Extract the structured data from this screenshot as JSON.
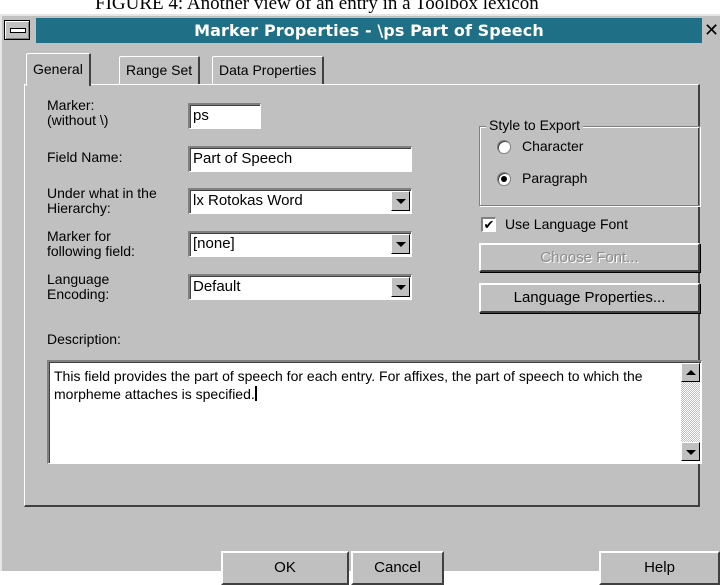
{
  "caption": "FIGURE 4: Another view of an entry in a Toolbox lexicon",
  "window": {
    "title": "Marker Properties - \\ps Part of Speech",
    "close_glyph": "✕"
  },
  "tabs": [
    {
      "label": "General",
      "active": true
    },
    {
      "label": "Range Set",
      "active": false
    },
    {
      "label": "Data Properties",
      "active": false
    }
  ],
  "form": {
    "marker_label_1": "Marker:",
    "marker_label_2": "(without \\)",
    "marker_value": "ps",
    "field_name_label": "Field Name:",
    "field_name_value": "Part of Speech",
    "hierarchy_label_1": "Under what in the",
    "hierarchy_label_2": "Hierarchy:",
    "hierarchy_value": "lx  Rotokas Word",
    "following_label_1": "Marker for",
    "following_label_2": "following field:",
    "following_value": "[none]",
    "encoding_label_1": "Language",
    "encoding_label_2": "Encoding:",
    "encoding_value": "Default",
    "description_label": "Description:",
    "description_value": "This field provides the part of speech for each entry. For affixes, the part of speech to which the morpheme attaches is specified."
  },
  "style_to_export": {
    "title": "Style to Export",
    "options": [
      {
        "label": "Character",
        "selected": false
      },
      {
        "label": "Paragraph",
        "selected": true
      }
    ]
  },
  "language_font": {
    "label": "Use Language Font",
    "checked": true,
    "check_glyph": "✔"
  },
  "buttons": {
    "choose_font": "Choose Font...",
    "language_properties": "Language Properties...",
    "ok": "OK",
    "cancel": "Cancel",
    "help": "Help"
  },
  "colors": {
    "title_bar": "#1f6f86",
    "dialog_face": "#c0c0c0"
  },
  "icons": {
    "system_menu": "system-menu-icon",
    "close": "close-icon"
  }
}
